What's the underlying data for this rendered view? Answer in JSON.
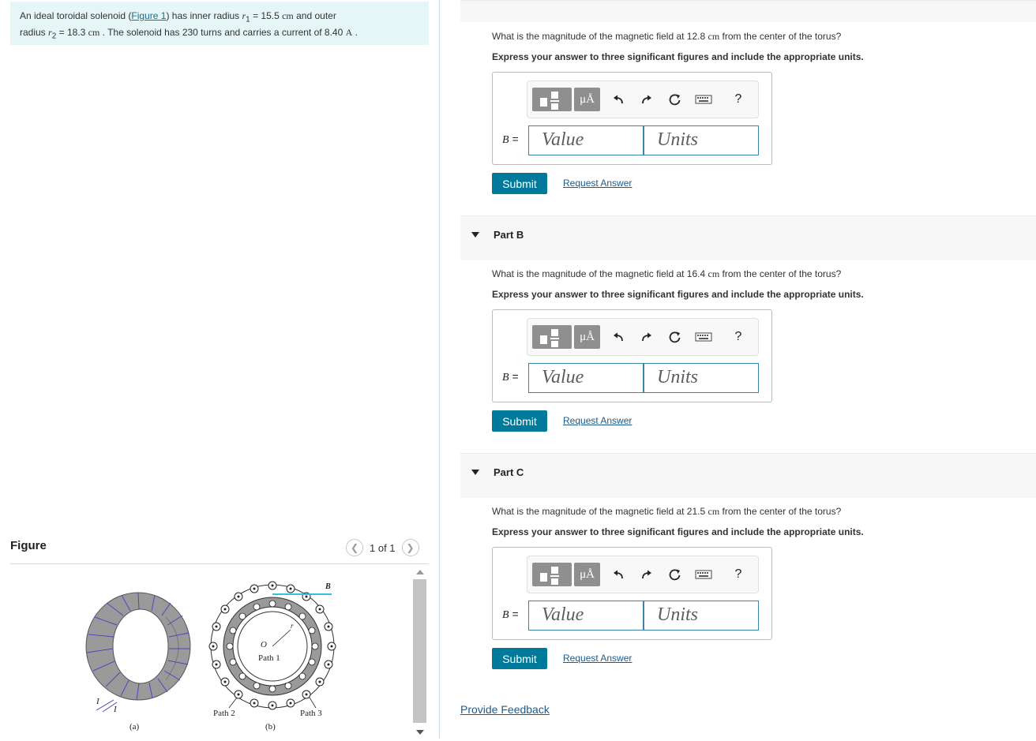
{
  "problem": {
    "text_prefix": "An ideal toroidal solenoid (",
    "figure_link": "Figure 1",
    "text_mid": ") has inner radius ",
    "r1_sym": "r",
    "r1_sub": "1",
    "r1_val": " = 15.5 ",
    "r1_unit": "cm",
    "and_outer": " and outer",
    "radius_word": "radius ",
    "r2_sym": "r",
    "r2_sub": "2",
    "r2_val": " = 18.3 ",
    "r2_unit": "cm",
    "text_end": " . The solenoid has 230 turns and carries a current of 8.40 ",
    "current_unit": "A",
    "period": " ."
  },
  "figure": {
    "title": "Figure",
    "pager": "1 of 1",
    "label_a": "(a)",
    "label_b": "(b)",
    "path1": "Path 1",
    "path2": "Path 2",
    "path3": "Path 3",
    "origin": "O",
    "r_label": "r",
    "b_vec": "B",
    "i_label1": "I",
    "i_label2": "I"
  },
  "parts": [
    {
      "question_prefix": "What is the magnitude of the magnetic field at 12.8 ",
      "unit": "cm",
      "question_suffix": " from the center of the torus?",
      "instruction": "Express your answer to three significant figures and include the appropriate units.",
      "var": "B",
      "eq": " =",
      "value_placeholder": "Value",
      "units_placeholder": "Units",
      "submit": "Submit",
      "request": "Request Answer"
    },
    {
      "title": "Part B",
      "question_prefix": "What is the magnitude of the magnetic field at 16.4 ",
      "unit": "cm",
      "question_suffix": " from the center of the torus?",
      "instruction": "Express your answer to three significant figures and include the appropriate units.",
      "var": "B",
      "eq": " =",
      "value_placeholder": "Value",
      "units_placeholder": "Units",
      "submit": "Submit",
      "request": "Request Answer"
    },
    {
      "title": "Part C",
      "question_prefix": "What is the magnitude of the magnetic field at 21.5 ",
      "unit": "cm",
      "question_suffix": " from the center of the torus?",
      "instruction": "Express your answer to three significant figures and include the appropriate units.",
      "var": "B",
      "eq": " =",
      "value_placeholder": "Value",
      "units_placeholder": "Units",
      "submit": "Submit",
      "request": "Request Answer"
    }
  ],
  "toolbar": {
    "unit_button": "μÅ",
    "help": "?"
  },
  "feedback": "Provide Feedback",
  "icons": [
    "templates-icon",
    "units-icon",
    "undo-icon",
    "redo-icon",
    "reset-icon",
    "keyboard-icon",
    "help-icon",
    "caret-down-icon",
    "chevron-left-icon",
    "chevron-right-icon"
  ]
}
